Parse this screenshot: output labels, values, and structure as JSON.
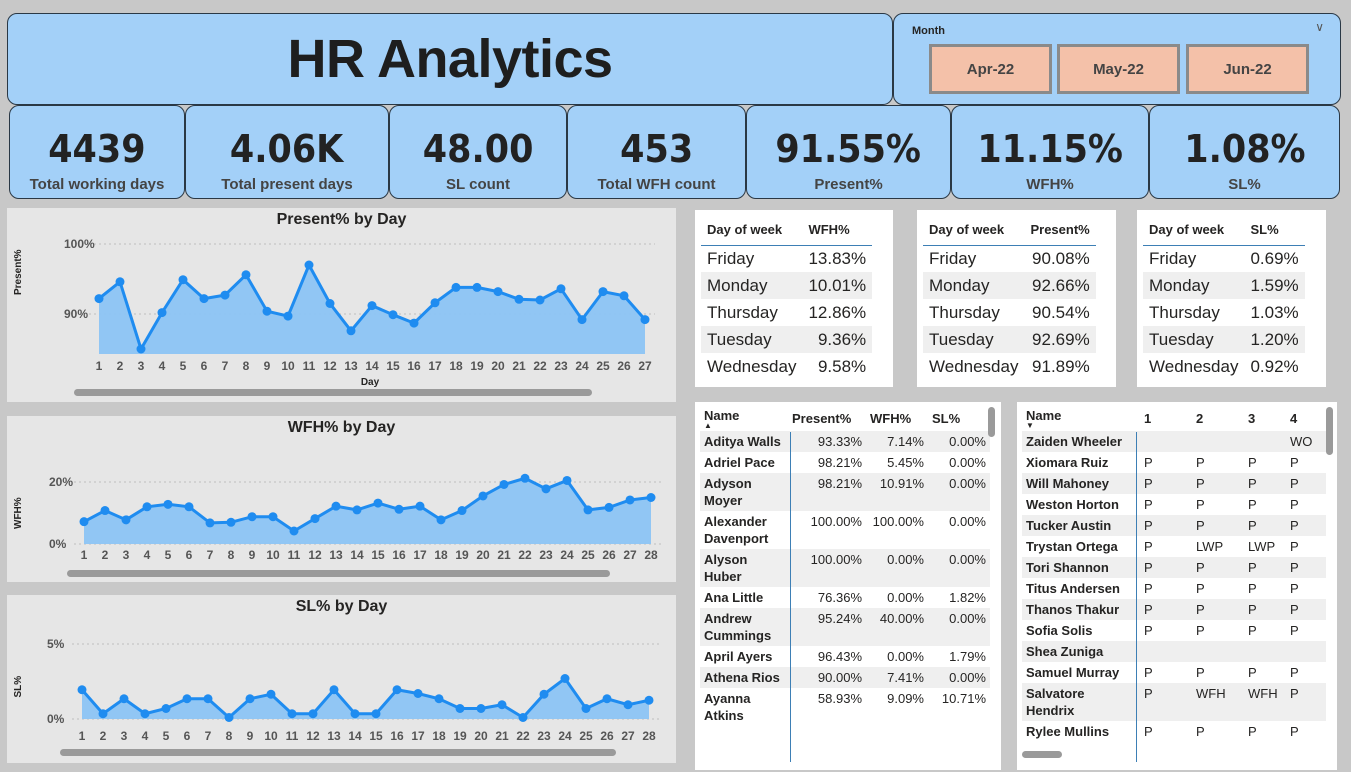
{
  "header": {
    "title": "HR Analytics"
  },
  "month_slicer": {
    "label": "Month",
    "options": [
      "Apr-22",
      "May-22",
      "Jun-22"
    ]
  },
  "kpis": [
    {
      "value": "4439",
      "label": "Total working days"
    },
    {
      "value": "4.06K",
      "label": "Total present days"
    },
    {
      "value": "48.00",
      "label": "SL count"
    },
    {
      "value": "453",
      "label": "Total WFH count"
    },
    {
      "value": "91.55%",
      "label": "Present%"
    },
    {
      "value": "11.15%",
      "label": "WFH%"
    },
    {
      "value": "1.08%",
      "label": "SL%"
    }
  ],
  "colors": {
    "panel_blue": "#a3d0f8",
    "slicer_button": "#f4c1a9",
    "series": "#1f8cf0",
    "area": "#8cc4f4"
  },
  "chart_data": [
    {
      "type": "area",
      "title": "Present% by Day",
      "xlabel": "Day",
      "ylabel": "Present%",
      "yticks": [
        "90%",
        "100%"
      ],
      "ylim": [
        84,
        101
      ],
      "x": [
        1,
        2,
        3,
        4,
        5,
        6,
        7,
        8,
        9,
        10,
        11,
        12,
        13,
        14,
        15,
        16,
        17,
        18,
        19,
        20,
        21,
        22,
        23,
        24,
        25,
        26,
        27
      ],
      "values": [
        92.2,
        94.6,
        85.0,
        90.2,
        94.9,
        92.2,
        92.7,
        95.6,
        90.4,
        89.7,
        97.0,
        91.5,
        87.6,
        91.2,
        89.9,
        88.7,
        91.6,
        93.8,
        93.8,
        93.2,
        92.1,
        92.0,
        93.6,
        89.2,
        93.2,
        92.6,
        89.2
      ]
    },
    {
      "type": "area",
      "title": "WFH% by Day",
      "ylabel": "WFH%",
      "yticks": [
        "0%",
        "20%"
      ],
      "ylim": [
        -3,
        28
      ],
      "x": [
        1,
        2,
        3,
        4,
        5,
        6,
        7,
        8,
        9,
        10,
        11,
        12,
        13,
        14,
        15,
        16,
        17,
        18,
        19,
        20,
        21,
        22,
        23,
        24,
        25,
        26,
        27,
        28
      ],
      "values": [
        7.2,
        10.8,
        7.8,
        12.0,
        12.8,
        12.0,
        6.8,
        7.0,
        8.8,
        8.8,
        4.2,
        8.2,
        12.2,
        11.0,
        13.2,
        11.2,
        12.2,
        7.8,
        10.8,
        15.5,
        19.2,
        21.2,
        17.8,
        20.5,
        11.0,
        11.8,
        14.2,
        15.0
      ]
    },
    {
      "type": "area",
      "title": "SL% by Day",
      "ylabel": "SL%",
      "yticks": [
        "0%",
        "5%"
      ],
      "ylim": [
        -0.3,
        5.3
      ],
      "x": [
        1,
        2,
        3,
        4,
        5,
        6,
        7,
        8,
        9,
        10,
        11,
        12,
        13,
        14,
        15,
        16,
        17,
        18,
        19,
        20,
        21,
        22,
        23,
        24,
        25,
        26,
        27,
        28
      ],
      "values": [
        1.95,
        0.35,
        1.35,
        0.35,
        0.7,
        1.35,
        1.35,
        0.1,
        1.35,
        1.65,
        0.35,
        0.35,
        1.95,
        0.35,
        0.35,
        1.95,
        1.7,
        1.35,
        0.7,
        0.7,
        0.95,
        0.1,
        1.65,
        2.7,
        0.7,
        1.35,
        0.95,
        1.25
      ]
    }
  ],
  "wfh_table": {
    "headers": [
      "Day of week",
      "WFH%"
    ],
    "rows": [
      [
        "Friday",
        "13.83%"
      ],
      [
        "Monday",
        "10.01%"
      ],
      [
        "Thursday",
        "12.86%"
      ],
      [
        "Tuesday",
        "9.36%"
      ],
      [
        "Wednesday",
        "9.58%"
      ]
    ]
  },
  "present_table": {
    "headers": [
      "Day of week",
      "Present%"
    ],
    "rows": [
      [
        "Friday",
        "90.08%"
      ],
      [
        "Monday",
        "92.66%"
      ],
      [
        "Thursday",
        "90.54%"
      ],
      [
        "Tuesday",
        "92.69%"
      ],
      [
        "Wednesday",
        "91.89%"
      ]
    ]
  },
  "sl_table": {
    "headers": [
      "Day of week",
      "SL%"
    ],
    "rows": [
      [
        "Friday",
        "0.69%"
      ],
      [
        "Monday",
        "1.59%"
      ],
      [
        "Thursday",
        "1.03%"
      ],
      [
        "Tuesday",
        "1.20%"
      ],
      [
        "Wednesday",
        "0.92%"
      ]
    ]
  },
  "employee_table": {
    "headers": [
      "Name",
      "Present%",
      "WFH%",
      "SL%"
    ],
    "rows": [
      [
        "Aditya Walls",
        "93.33%",
        "7.14%",
        "0.00%"
      ],
      [
        "Adriel Pace",
        "98.21%",
        "5.45%",
        "0.00%"
      ],
      [
        "Adyson Moyer",
        "98.21%",
        "10.91%",
        "0.00%"
      ],
      [
        "Alexander Davenport",
        "100.00%",
        "100.00%",
        "0.00%"
      ],
      [
        "Alyson Huber",
        "100.00%",
        "0.00%",
        "0.00%"
      ],
      [
        "Ana Little",
        "76.36%",
        "0.00%",
        "1.82%"
      ],
      [
        "Andrew Cummings",
        "95.24%",
        "40.00%",
        "0.00%"
      ],
      [
        "April Ayers",
        "96.43%",
        "0.00%",
        "1.79%"
      ],
      [
        "Athena Rios",
        "90.00%",
        "7.41%",
        "0.00%"
      ],
      [
        "Ayanna Atkins",
        "58.93%",
        "9.09%",
        "10.71%"
      ]
    ]
  },
  "attendance_table": {
    "headers": [
      "Name",
      "1",
      "2",
      "3",
      "4"
    ],
    "rows": [
      [
        "Zaiden Wheeler",
        "",
        "",
        "",
        "WO"
      ],
      [
        "Xiomara Ruiz",
        "P",
        "P",
        "P",
        "P"
      ],
      [
        "Will Mahoney",
        "P",
        "P",
        "P",
        "P"
      ],
      [
        "Weston Horton",
        "P",
        "P",
        "P",
        "P"
      ],
      [
        "Tucker Austin",
        "P",
        "P",
        "P",
        "P"
      ],
      [
        "Trystan Ortega",
        "P",
        "LWP",
        "LWP",
        "P"
      ],
      [
        "Tori Shannon",
        "P",
        "P",
        "P",
        "P"
      ],
      [
        "Titus Andersen",
        "P",
        "P",
        "P",
        "P"
      ],
      [
        "Thanos Thakur",
        "P",
        "P",
        "P",
        "P"
      ],
      [
        "Sofia Solis",
        "P",
        "P",
        "P",
        "P"
      ],
      [
        "Shea Zuniga",
        "",
        "",
        "",
        ""
      ],
      [
        "Samuel Murray",
        "P",
        "P",
        "P",
        "P"
      ],
      [
        "Salvatore Hendrix",
        "P",
        "WFH",
        "WFH",
        "P"
      ],
      [
        "Rylee Mullins",
        "P",
        "P",
        "P",
        "P"
      ]
    ]
  }
}
